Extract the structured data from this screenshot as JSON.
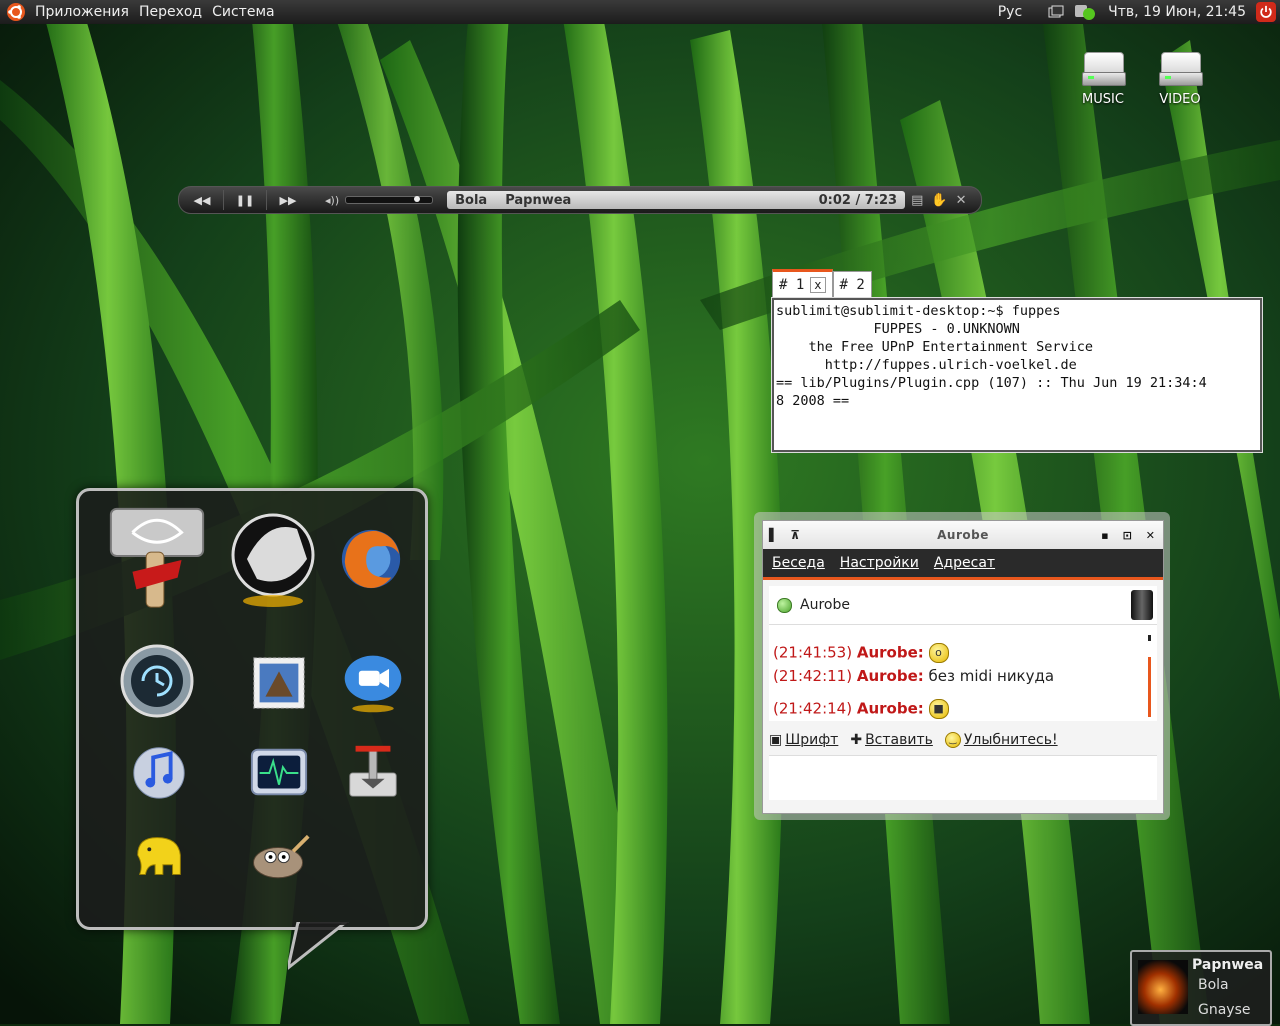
{
  "top_panel": {
    "menus": [
      "Приложения",
      "Переход",
      "Система"
    ],
    "keyboard_layout": "Рус",
    "clock": "Чтв, 19 Июн, 21:45"
  },
  "desktop_icons": [
    {
      "label": "MUSIC",
      "icon": "drive-icon"
    },
    {
      "label": "VIDEO",
      "icon": "drive-icon"
    }
  ],
  "player": {
    "artist": "Bola",
    "title": "Papnwea",
    "time": "0:02  /  7:23",
    "volume_level": 0.85
  },
  "terminal": {
    "tabs": [
      {
        "label": "# 1",
        "close": "x",
        "active": true
      },
      {
        "label": "# 2",
        "active": false
      }
    ],
    "lines": [
      "sublimit@sublimit-desktop:~$ fuppes",
      "            FUPPES - 0.UNKNOWN",
      "    the Free UPnP Entertainment Service",
      "      http://fuppes.ulrich-voelkel.de",
      "",
      "== lib/Plugins/Plugin.cpp (107) :: Thu Jun 19 21:34:4",
      "8 2008 =="
    ]
  },
  "dock": {
    "apps": [
      "thor-hammer-icon",
      "winamp-hand-icon",
      "firefox-icon",
      "time-machine-icon",
      "mail-stamp-icon",
      "video-chat-icon",
      "itunes-icon",
      "activity-monitor-icon",
      "installer-icon",
      "elephant-icon",
      "gimp-icon"
    ]
  },
  "chat": {
    "title": "Aurobe",
    "menu": [
      "Беседа",
      "Настройки",
      "Адресат"
    ],
    "contact": "Aurobe",
    "messages": [
      {
        "time": "(21:41:53)",
        "nick": "Aurobe:",
        "text": "",
        "smiley": "surprised"
      },
      {
        "time": "(21:42:11)",
        "nick": "Aurobe:",
        "text": "без midi никуда",
        "smiley": ""
      },
      {
        "time": "(21:42:14)",
        "nick": "Aurobe:",
        "text": "",
        "smiley": "cool"
      }
    ],
    "tools": [
      "Шрифт",
      "Вставить",
      "Улыбнитесь!"
    ]
  },
  "notification": {
    "title": "Papnwea",
    "artist": "Bola",
    "album": "Gnayse"
  },
  "colors": {
    "accent": "#e8571d",
    "nick": "#c01818",
    "panel": "#1c1c1c"
  }
}
